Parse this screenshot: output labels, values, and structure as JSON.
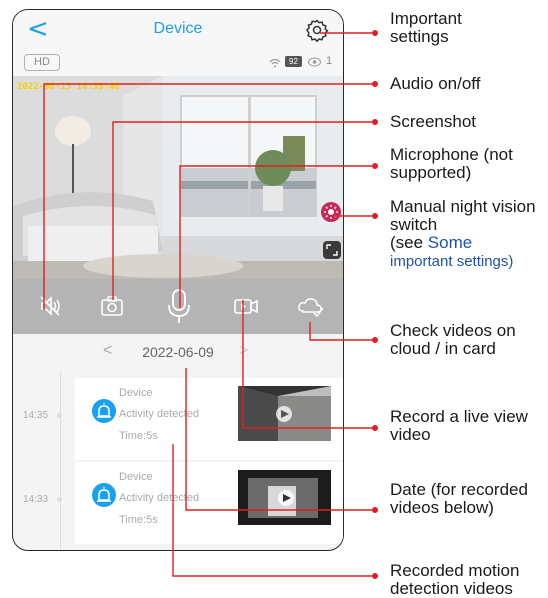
{
  "app": {
    "title": "Device",
    "back_glyph": "<",
    "settings_icon": "gear-icon"
  },
  "status": {
    "quality": "HD",
    "battery": "92",
    "viewers": "1"
  },
  "video": {
    "timestamp": "2022-06-15  10:39:48"
  },
  "controls": {
    "icons": [
      "audio-off-icon",
      "screenshot-icon",
      "microphone-icon",
      "record-icon",
      "cloud-icon"
    ]
  },
  "date_nav": {
    "prev": "<",
    "date": "2022-06-09",
    "next": ">"
  },
  "events": [
    {
      "time": "14:35",
      "device": "Device",
      "activity": "Activity detected",
      "duration": "Time:5s"
    },
    {
      "time": "14:33",
      "device": "Device",
      "activity": "Activity detected",
      "duration": "Time:5s"
    }
  ],
  "annotations": {
    "important_settings": "Important settings",
    "audio": "Audio on/off",
    "screenshot": "Screenshot",
    "microphone": "Microphone (not supported)",
    "night_vision_1": "Manual night vision switch",
    "night_vision_2": "(see ",
    "night_vision_3": "Some",
    "night_vision_4": "important settings)",
    "check_videos": "Check videos on cloud / in card",
    "record": "Record a live view video",
    "date": "Date (for recorded videos below)",
    "recorded": "Recorded motion detection videos"
  },
  "colors": {
    "accent": "#1aa0f0",
    "annotation_line": "#e02020",
    "night_button": "#c8285a",
    "timestamp": "#f5d000"
  }
}
